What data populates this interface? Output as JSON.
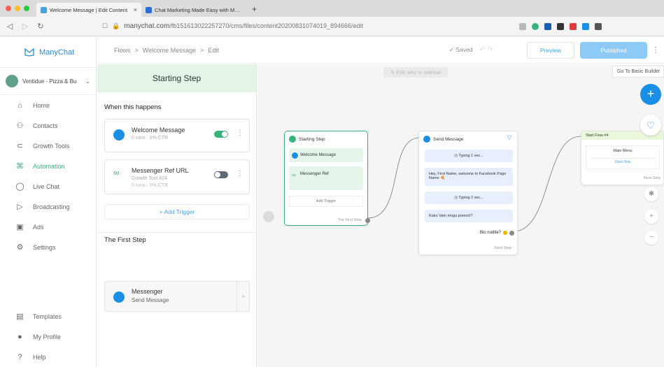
{
  "browser": {
    "tabs": [
      {
        "title": "Welcome Message | Edit Content",
        "active": true
      },
      {
        "title": "Chat Marketing Made Easy with ManyChat",
        "active": false
      }
    ],
    "url_prefix": "manychat.com",
    "url_path": "/fb151613022257270/cms/files/content20200831074019_894666/edit"
  },
  "nav": {
    "logo": "ManyChat",
    "page_name": "Ventidue - Pizza & Bu",
    "items": [
      {
        "label": "Home",
        "icon": "home-icon"
      },
      {
        "label": "Contacts",
        "icon": "user-icon"
      },
      {
        "label": "Growth Tools",
        "icon": "magnet-icon"
      },
      {
        "label": "Automation",
        "icon": "automation-icon",
        "active": true
      },
      {
        "label": "Live Chat",
        "icon": "chat-icon"
      },
      {
        "label": "Broadcasting",
        "icon": "send-icon"
      },
      {
        "label": "Ads",
        "icon": "ads-icon"
      },
      {
        "label": "Settings",
        "icon": "gear-icon"
      }
    ],
    "bottom_items": [
      {
        "label": "Templates",
        "icon": "templates-icon"
      },
      {
        "label": "My Profile",
        "icon": "avatar"
      },
      {
        "label": "Help",
        "icon": "help-icon"
      }
    ]
  },
  "header": {
    "crumbs": [
      "Flows",
      ">",
      "Welcome Message",
      ">",
      "Edit"
    ],
    "saved": "✓ Saved",
    "preview": "Preview",
    "published": "Published"
  },
  "panel": {
    "title": "Starting Step",
    "when_title": "When this happens",
    "triggers": [
      {
        "name": "Welcome Message",
        "sub": "0 runs · 0% CTR",
        "sub2": "",
        "enabled": true
      },
      {
        "name": "Messenger Ref URL",
        "sub": "Growth Tool #24",
        "sub2": "0 runs · 0% CTR",
        "enabled": false
      }
    ],
    "add_trigger": "+ Add Trigger",
    "first_step_title": "The First Step",
    "first_step": {
      "name": "Messenger",
      "sub": "Send Message"
    }
  },
  "canvas": {
    "hint": "✎ Edit step in sidebar",
    "basic_builder": "Go To Basic Builder",
    "start_node": {
      "title": "Starting Step",
      "rows": [
        "Welcome Message",
        "Messenger Ref"
      ],
      "add": "Add Trigger",
      "footer": "The First Step"
    },
    "msg_node": {
      "title": "Send Message",
      "typing1": "Typing 1 sec...",
      "text1": "Hey, First Name, welcome to Facebook Page Name 🍕",
      "typing2": "Typing 2 sec...",
      "text2": "Kako Vam mogu pomoći?",
      "button": "Bio nudite?",
      "footer": "Next Step"
    },
    "flow_node": {
      "head": "Start Flow #4",
      "title": "Main Menu",
      "button": "Open flow",
      "footer": "Next Step"
    }
  },
  "colors": {
    "accent": "#1a8fe6",
    "green": "#36b37e",
    "publish": "#8ecaf6"
  }
}
